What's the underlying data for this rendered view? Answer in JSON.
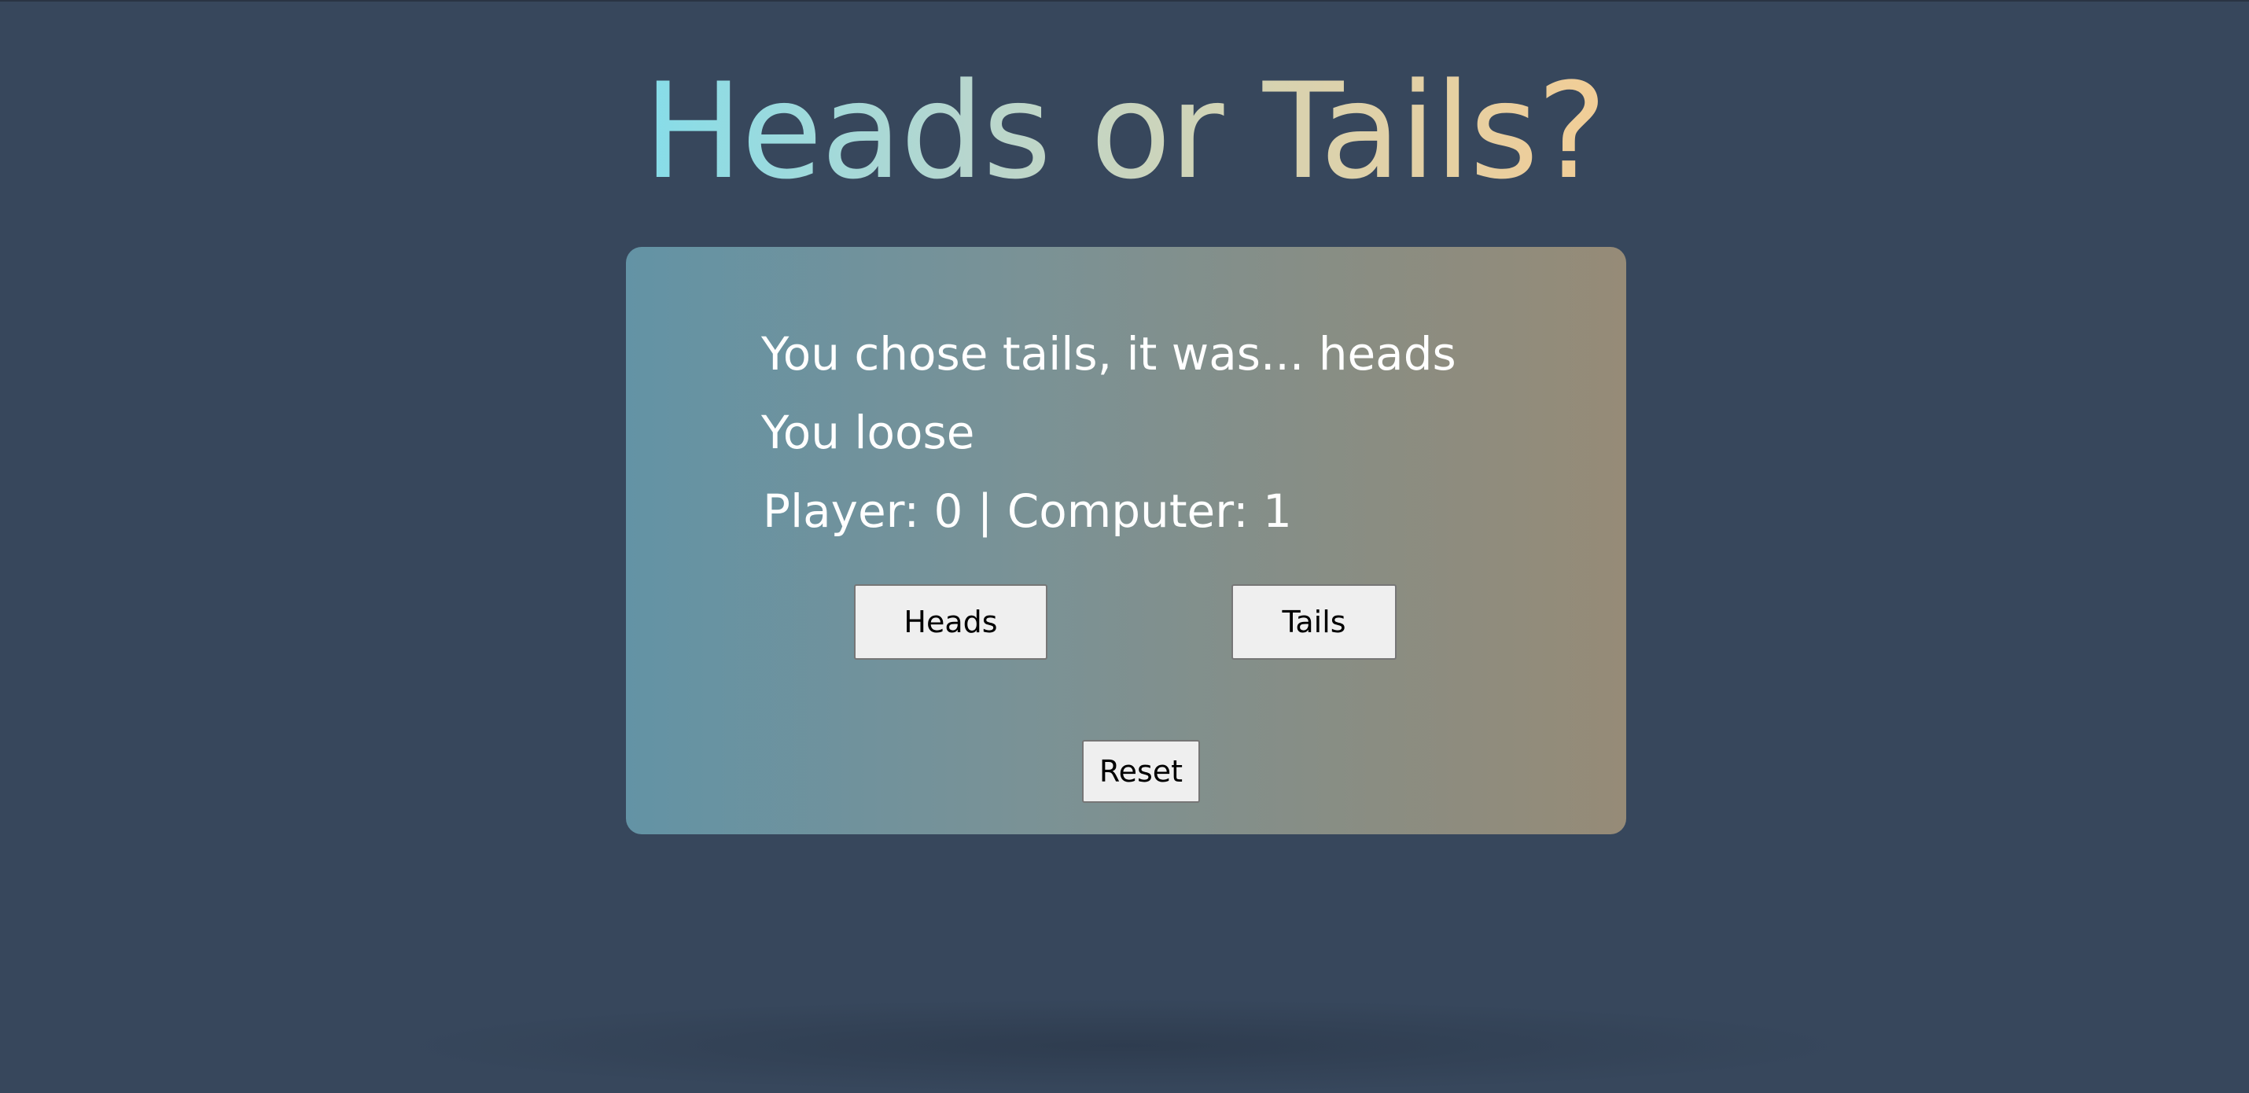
{
  "title": "Heads or Tails?",
  "result": {
    "choice_text": "You chose tails, it was... heads",
    "outcome_text": "You loose",
    "score_text": "Player: 0 | Computer: 1"
  },
  "buttons": {
    "heads": "Heads",
    "tails": "Tails",
    "reset": "Reset"
  },
  "colors": {
    "background": "#37475c",
    "title_gradient_start": "#86dde9",
    "title_gradient_end": "#f2cd96",
    "card_gradient_start": "#6393a5",
    "card_gradient_end": "#968b77"
  }
}
